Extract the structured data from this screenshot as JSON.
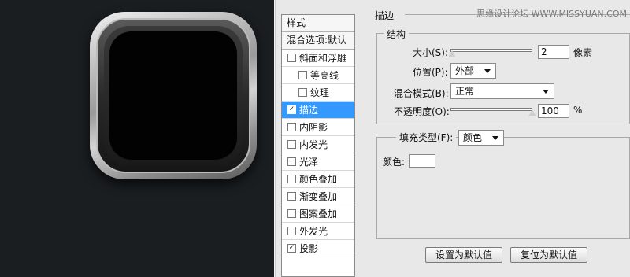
{
  "watermark": "思缘设计论坛 WWW.MISSYUAN.COM",
  "style_list": {
    "header": "样式",
    "blend_options": "混合选项:默认",
    "items": [
      {
        "label": "斜面和浮雕",
        "checked": false,
        "sub": false,
        "active": false
      },
      {
        "label": "等高线",
        "checked": false,
        "sub": true,
        "active": false
      },
      {
        "label": "纹理",
        "checked": false,
        "sub": true,
        "active": false
      },
      {
        "label": "描边",
        "checked": true,
        "sub": false,
        "active": true
      },
      {
        "label": "内阴影",
        "checked": false,
        "sub": false,
        "active": false
      },
      {
        "label": "内发光",
        "checked": false,
        "sub": false,
        "active": false
      },
      {
        "label": "光泽",
        "checked": false,
        "sub": false,
        "active": false
      },
      {
        "label": "颜色叠加",
        "checked": false,
        "sub": false,
        "active": false
      },
      {
        "label": "渐变叠加",
        "checked": false,
        "sub": false,
        "active": false
      },
      {
        "label": "图案叠加",
        "checked": false,
        "sub": false,
        "active": false
      },
      {
        "label": "外发光",
        "checked": false,
        "sub": false,
        "active": false
      },
      {
        "label": "投影",
        "checked": true,
        "sub": false,
        "active": false
      }
    ]
  },
  "stroke": {
    "title": "描边",
    "structure_title": "结构",
    "size_label": "大小(S):",
    "size_value": "2",
    "size_unit": "像素",
    "size_fraction": 0.02,
    "position_label": "位置(P):",
    "position_value": "外部",
    "blend_label": "混合模式(B):",
    "blend_value": "正常",
    "opacity_label": "不透明度(O):",
    "opacity_value": "100",
    "opacity_unit": "%",
    "opacity_fraction": 1.0,
    "fill_type_label": "填充类型(F):",
    "fill_type_value": "颜色",
    "color_label": "颜色:",
    "color_value": "#ffffff"
  },
  "buttons": {
    "set_default": "设置为默认值",
    "reset_default": "复位为默认值"
  }
}
